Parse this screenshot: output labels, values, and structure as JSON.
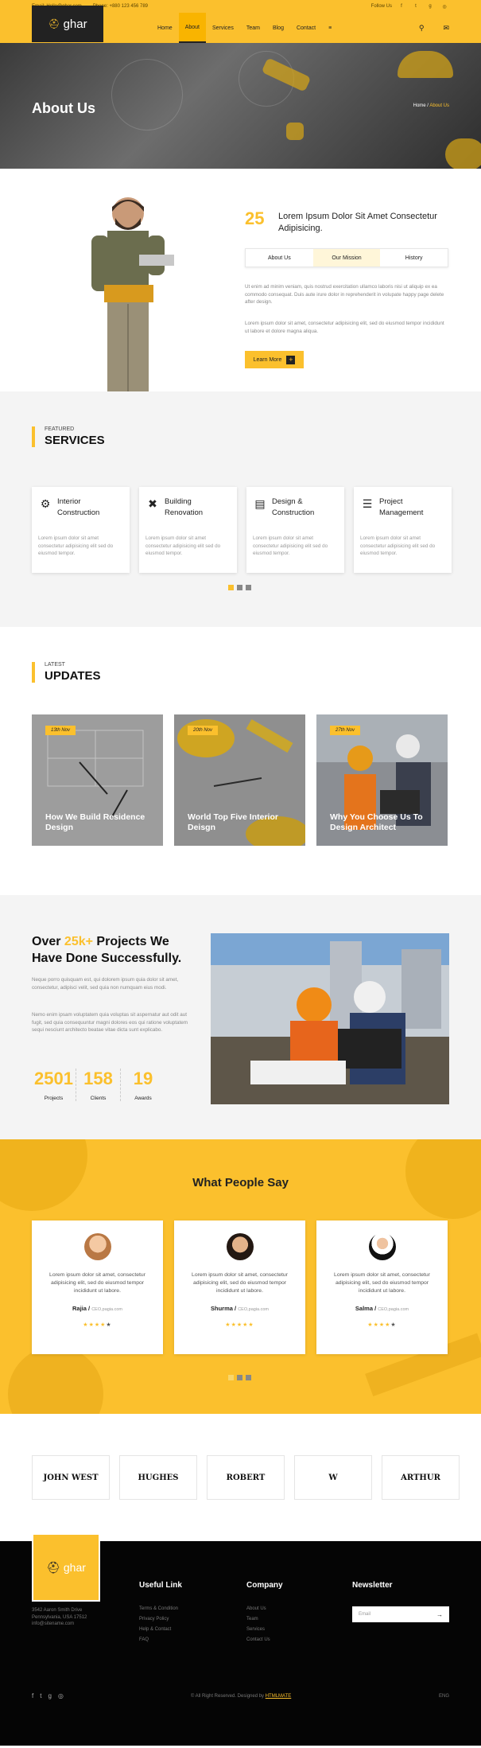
{
  "topbar": {
    "email": "Email: Hello@ghar.com",
    "phone": "Phone: +880 123 456 789",
    "follow": "Follow Us",
    "social_icons": [
      "facebook-icon",
      "twitter-icon",
      "google-plus-icon",
      "instagram-icon"
    ]
  },
  "nav": {
    "logo_text": "ghar",
    "items": [
      {
        "label": "Home"
      },
      {
        "label": "About"
      },
      {
        "label": "Services"
      },
      {
        "label": "Team"
      },
      {
        "label": "Blog"
      },
      {
        "label": "Contact"
      },
      {
        "label": "≡"
      }
    ],
    "active_index": 1,
    "colors": {
      "accent": "#fbc02d",
      "dark": "#222222"
    }
  },
  "hero": {
    "title": "About Us",
    "breadcrumb_home": "Home",
    "breadcrumb_sep": "/",
    "breadcrumb_current": "About Us"
  },
  "about": {
    "number": "25",
    "headline": "Lorem Ipsum Dolor Sit Amet Consectetur Adipisicing.",
    "tabs": [
      "About Us",
      "Our Mission",
      "History"
    ],
    "active_tab": 1,
    "p1": "Ut enim ad minim veniam, quis nostrud exercitation ullamco laboris nisi ut aliquip ex ea commodo consequat. Duis aute irure dolor in reprehenderit in volupate happy page delete after design.",
    "p2": "Lorem ipsum dolor sit amet, consectetur adipisicing elit, sed do eiusmod tempor incididunt ut labore et dolore magna aliqua.",
    "button": "Learn More",
    "button_icon": "+"
  },
  "services": {
    "kicker": "FEATURED",
    "title": "SERVICES",
    "cards": [
      {
        "icon": "gear-icon",
        "title": "Interior Construction",
        "desc": "Lorem ipsum dolor sit amet consectetur adipisicing elit sed do eiusmod tempor."
      },
      {
        "icon": "tools-icon",
        "title": "Building Renovation",
        "desc": "Lorem ipsum dolor sit amet consectetur adipisicing elit sed do eiusmod tempor."
      },
      {
        "icon": "book-icon",
        "title": "Design & Construction",
        "desc": "Lorem ipsum dolor sit amet consectetur adipisicing elit sed do eiusmod tempor."
      },
      {
        "icon": "clipboard-icon",
        "title": "Project Management",
        "desc": "Lorem ipsum dolor sit amet consectetur adipisicing elit sed do eiusmod tempor."
      }
    ]
  },
  "updates": {
    "kicker": "LATEST",
    "title": "UPDATES",
    "posts": [
      {
        "date": "13th Nov",
        "title": "How We Build Residence Design"
      },
      {
        "date": "20th Nov",
        "title": "World Top Five Interior Deisgn"
      },
      {
        "date": "27th Nov",
        "title": "Why You Choose Us To Design Architect"
      }
    ]
  },
  "projects": {
    "heading_pre": "Over ",
    "heading_hl": "25k+",
    "heading_post": " Projects We Have Done Successfully.",
    "p1": "Neque porro quisquam est, qui dolorem ipsum quia dolor sit amet, consectetur, adipisci velit, sed quia non numquam eius modi.",
    "p2": "Nemo enim ipsam voluptatem quia voluptas sit aspernatur aut odit aut fugit, sed quia consequuntur magni dolores eos qui ratione voluptatem sequi nesciunt architecto beatae vitae dicta sunt explicabo.",
    "stats": [
      {
        "value": "2501",
        "label": "Projects"
      },
      {
        "value": "158",
        "label": "Clients"
      },
      {
        "value": "19",
        "label": "Awards"
      }
    ]
  },
  "testimonials": {
    "title": "What People Say",
    "items": [
      {
        "quote": "Lorem ipsum dolor sit amet, consectetur adipisicing elit, sed do eiusmod tempor incididunt ut labore.",
        "name": "Rajia",
        "role": "CEO,pagia.com",
        "rating": 4
      },
      {
        "quote": "Lorem ipsum dolor sit amet, consectetur adipisicing elit, sed do eiusmod tempor incididunt ut labore.",
        "name": "Shurma",
        "role": "CEO,pagia.com",
        "rating": 5
      },
      {
        "quote": "Lorem ipsum dolor sit amet, consectetur adipisicing elit, sed do eiusmod tempor incididunt ut labore.",
        "name": "Salma",
        "role": "CEO,pagia.com",
        "rating": 4
      }
    ]
  },
  "brands": [
    "JOHN WEST",
    "HUGHES",
    "ROBERT",
    "W",
    "ARTHUR"
  ],
  "footer": {
    "logo_text": "ghar",
    "address": [
      "3542 Aaron Smith Drive",
      "Pennsylvania, USA 17512",
      "info@sitename.com"
    ],
    "useful_title": "Useful Link",
    "useful_links": [
      "Terms & Condition",
      "Privacy Policy",
      "Help & Contact",
      "FAQ"
    ],
    "company_title": "Company",
    "company_links": [
      "About Us",
      "Team",
      "Services",
      "Contact Us"
    ],
    "newsletter_title": "Newsletter",
    "newsletter_placeholder": "Email",
    "newsletter_arrow": "→",
    "copyright": "© All Right Reserved. Designed by ",
    "copyright_brand": "HTMLMATE",
    "lang": "ENG",
    "social_icons": [
      "facebook-icon",
      "twitter-icon",
      "google-plus-icon",
      "instagram-icon"
    ]
  }
}
